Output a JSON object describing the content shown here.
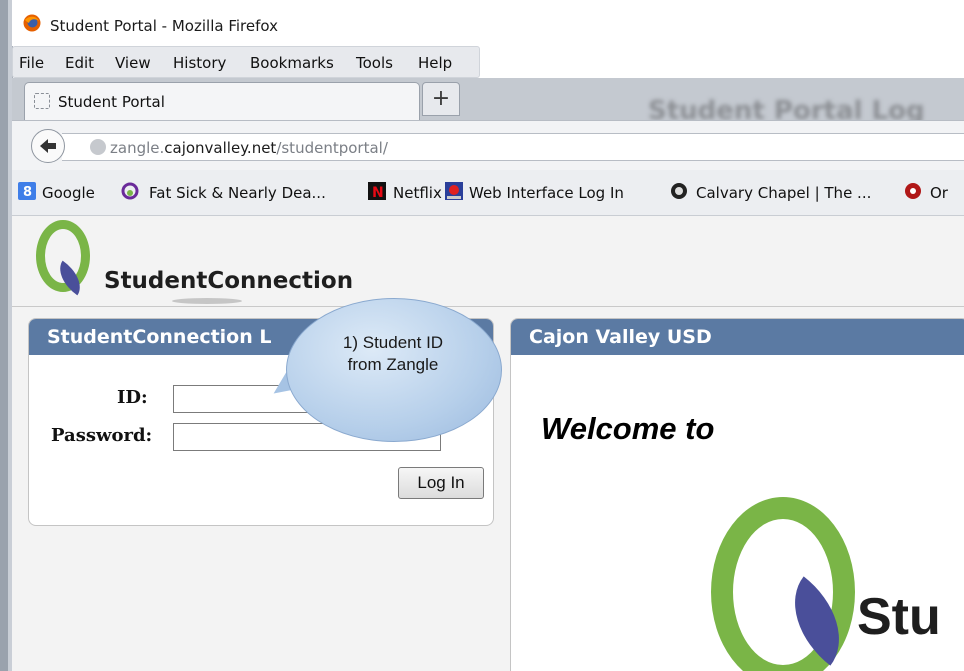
{
  "window": {
    "title": "Student Portal - Mozilla Firefox"
  },
  "menu": {
    "items": [
      {
        "label": "File"
      },
      {
        "label": "Edit"
      },
      {
        "label": "View"
      },
      {
        "label": "History"
      },
      {
        "label": "Bookmarks"
      },
      {
        "label": "Tools"
      },
      {
        "label": "Help"
      }
    ]
  },
  "tabs": [
    {
      "label": "Student Portal"
    }
  ],
  "new_tab_label": "+",
  "nav": {
    "url_prefix": "zangle.",
    "url_host": "cajonvalley.net",
    "url_path": "/studentportal/"
  },
  "bookmarks": {
    "items": [
      {
        "label": "Google"
      },
      {
        "label": "Fat Sick & Nearly Dea..."
      },
      {
        "label": "Netflix"
      },
      {
        "label": "Web Interface Log In"
      },
      {
        "label": "Calvary Chapel | The ..."
      },
      {
        "label": "Or"
      }
    ]
  },
  "page": {
    "background_title": "Student Portal Log",
    "logo_text": "StudentConnection",
    "login_panel": {
      "header": "StudentConnection L",
      "id_label": "ID:",
      "password_label": "Password:",
      "login_button": "Log In"
    },
    "info_panel": {
      "header": "Cajon Valley USD",
      "welcome": "Welcome to",
      "big_logo_text": "Stu"
    },
    "callout": {
      "line1": "1) Student ID",
      "line2": "from Zangle"
    }
  },
  "colors": {
    "panel_header": "#5b7aa3",
    "logo_green": "#7ab547",
    "logo_leaf": "#4a4f9a"
  }
}
